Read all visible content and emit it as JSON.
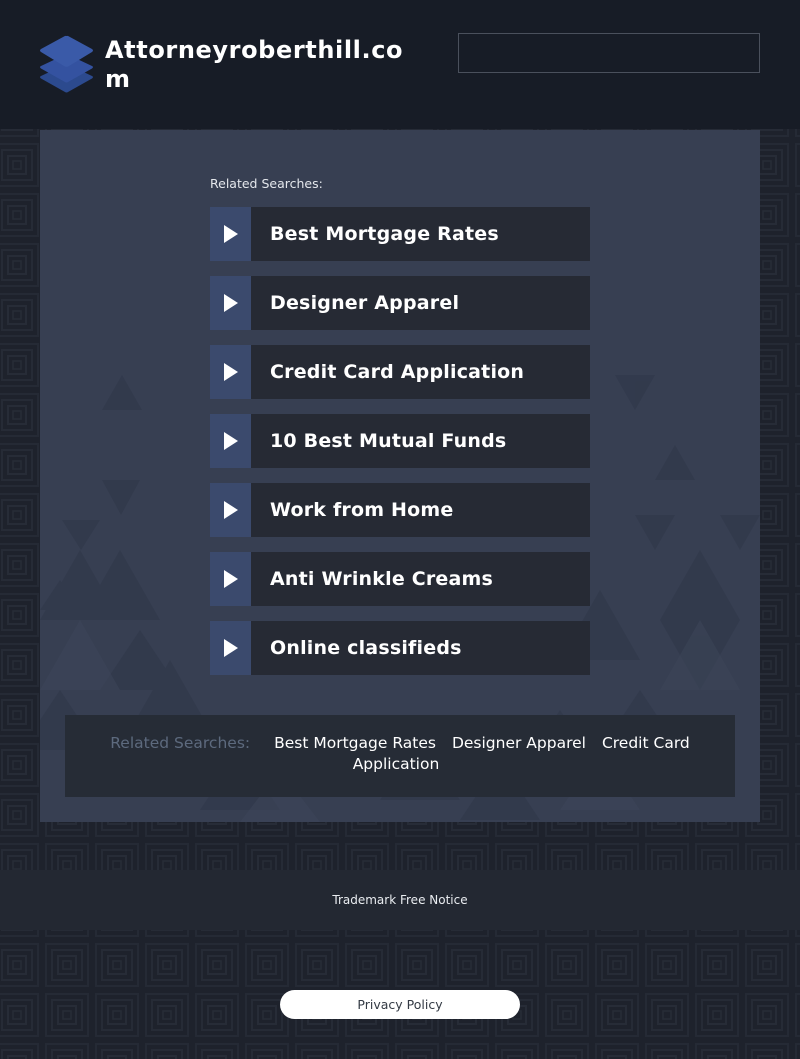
{
  "header": {
    "site_title": "Attorneyroberthill.com",
    "logo_icon": "layers-stack-icon",
    "search": {
      "value": "",
      "placeholder": ""
    }
  },
  "main": {
    "related_label": "Related Searches:",
    "items": [
      {
        "label": "Best Mortgage Rates",
        "icon": "play-arrow-icon"
      },
      {
        "label": "Designer Apparel",
        "icon": "play-arrow-icon"
      },
      {
        "label": "Credit Card Application",
        "icon": "play-arrow-icon"
      },
      {
        "label": "10 Best Mutual Funds",
        "icon": "play-arrow-icon"
      },
      {
        "label": "Work from Home",
        "icon": "play-arrow-icon"
      },
      {
        "label": "Anti Wrinkle Creams",
        "icon": "play-arrow-icon"
      },
      {
        "label": "Online classifieds",
        "icon": "play-arrow-icon"
      }
    ]
  },
  "bottom_related": {
    "label": "Related Searches:",
    "links": [
      "Best Mortgage Rates",
      "Designer Apparel",
      "Credit Card Application"
    ]
  },
  "footer": {
    "trademark": "Trademark Free Notice",
    "privacy": "Privacy Policy"
  },
  "colors": {
    "header_bg": "#171c26",
    "page_bg": "#1e222c",
    "panel_bg": "#373f52",
    "item_bg": "#262a34",
    "arrow_bg": "#3b4a6d",
    "logo_blue": "#3a5aa8",
    "muted_label": "#5d6a7e"
  }
}
